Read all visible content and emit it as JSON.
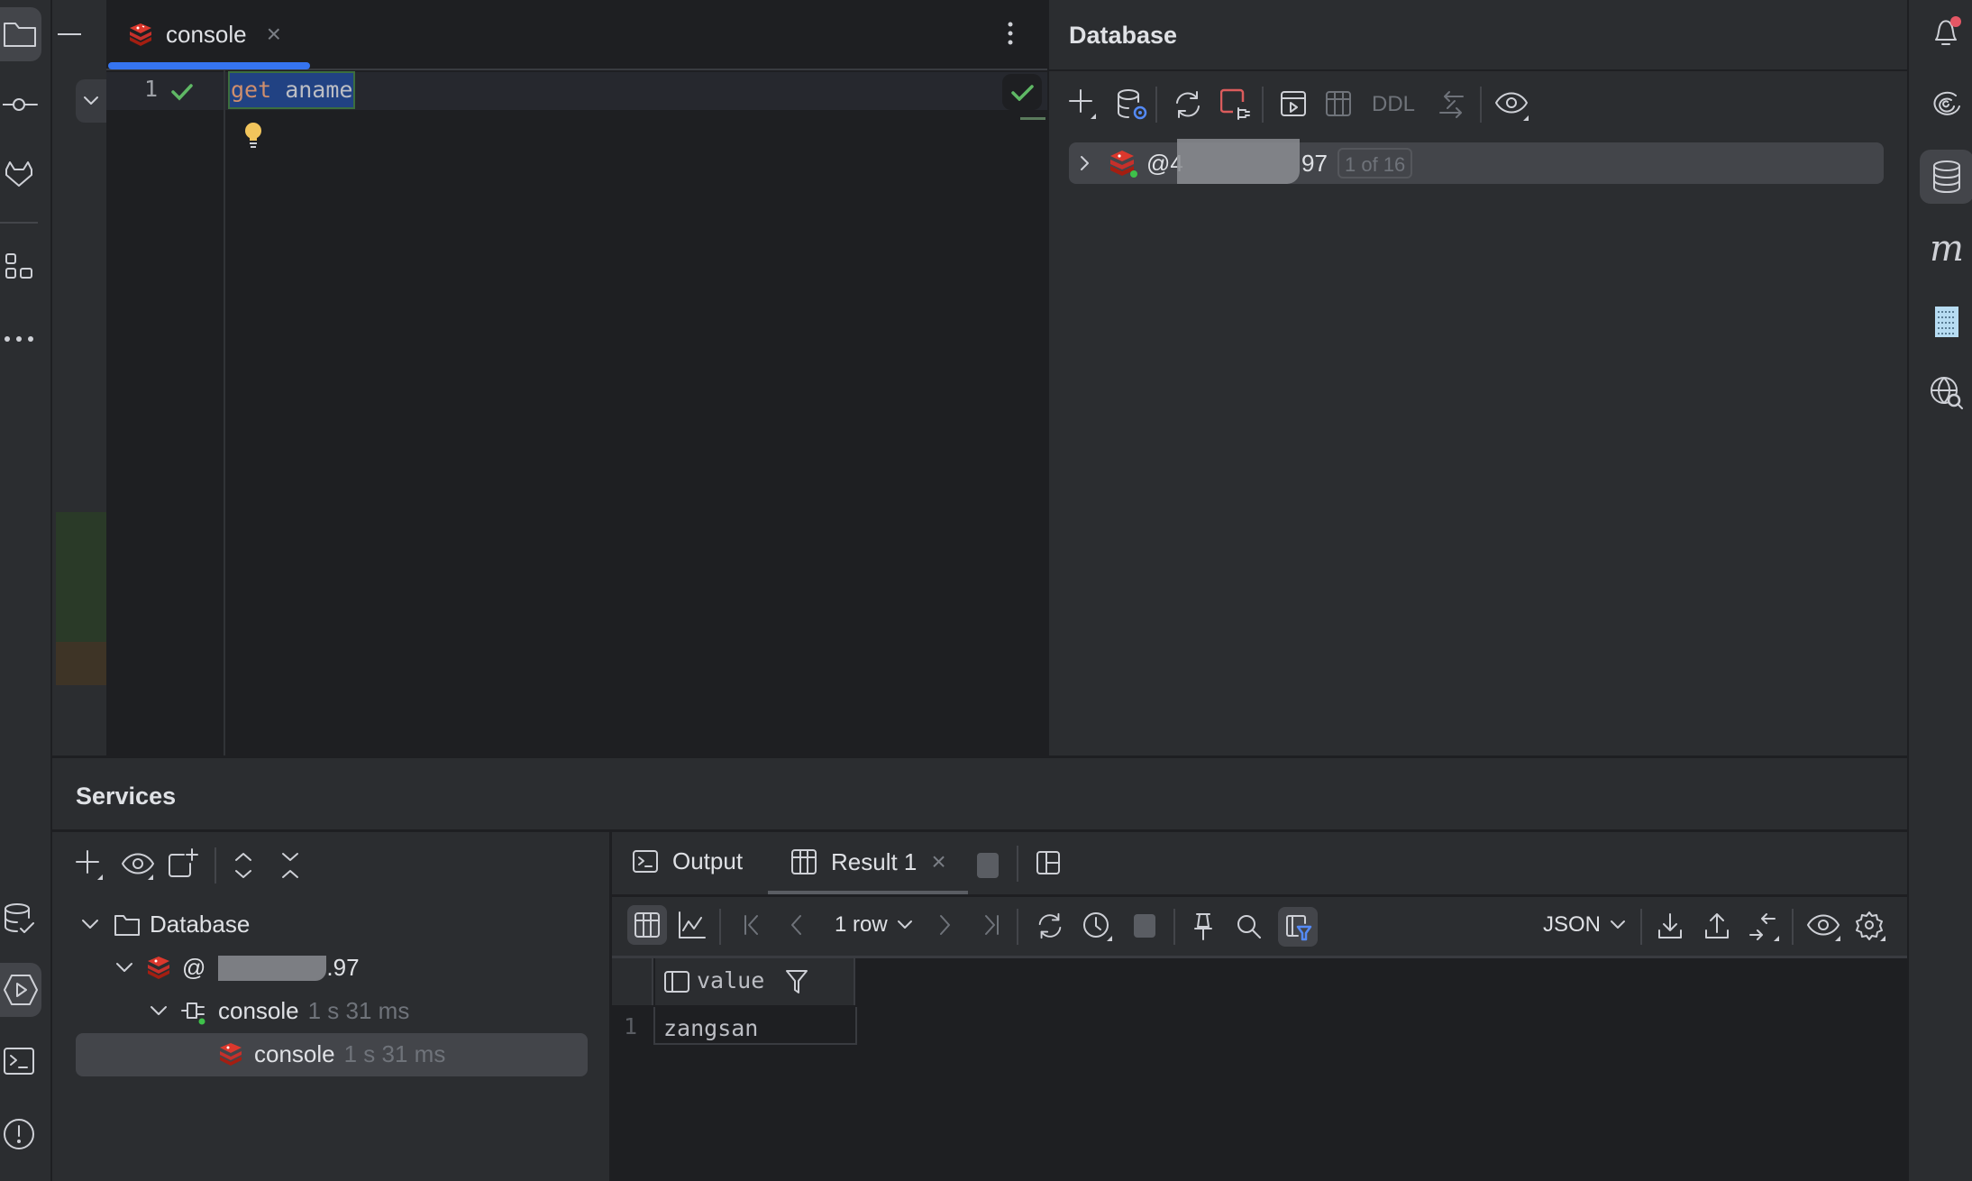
{
  "editor": {
    "tab": {
      "label": "console",
      "close": "×",
      "icon": "redis-icon"
    },
    "more_icon": "more-vertical-icon",
    "minimize_icon": "minimize-icon",
    "lines": [
      {
        "number": "1",
        "status": "check-icon",
        "tokens": [
          {
            "text": "get",
            "kind": "keyword"
          },
          {
            "text": " aname",
            "kind": "identifier"
          }
        ]
      }
    ],
    "intention_icon": "lightbulb-icon",
    "inspection_status": "check-icon"
  },
  "left_bar": {
    "top": [
      "folder-icon",
      "commit-icon",
      "gitlab-icon",
      "structure-icon",
      "more-icon"
    ],
    "bottom": [
      "database-changes-icon",
      "services-icon",
      "terminal-icon",
      "problems-icon"
    ],
    "active": "folder-icon"
  },
  "right_bar": {
    "items": [
      "notifications-icon",
      "ai-assistant-icon",
      "database-icon",
      "maven-icon",
      "binary-icon",
      "web-search-icon"
    ],
    "active": "database-icon",
    "notification_color": "#e55765"
  },
  "database_panel": {
    "title": "Database",
    "toolbar": [
      "add-icon",
      "data-source-properties-icon",
      "refresh-icon",
      "disconnect-icon",
      "query-console-icon",
      "table-icon",
      "compare-icon",
      "view-options-icon"
    ],
    "ddl_label": "DDL",
    "tree": [
      {
        "prefix": "@4",
        "redacted": true,
        "suffix": "97",
        "badge": "1 of 16",
        "expanded": false,
        "selected": true
      }
    ]
  },
  "services": {
    "title": "Services",
    "toolbar": [
      "add-icon",
      "view-options-icon",
      "new-tab-icon",
      "expand-all-icon",
      "collapse-all-icon"
    ],
    "tree": [
      {
        "label": "Database",
        "icon": "folder-icon",
        "expanded": true
      },
      {
        "prefix": "@",
        "redacted": true,
        "suffix": ".97",
        "icon": "redis-icon",
        "expanded": true
      },
      {
        "label": "console",
        "time": "1 s 31 ms",
        "icon": "plug-icon",
        "expanded": true
      },
      {
        "label": "console",
        "time": "1 s 31 ms",
        "icon": "redis-icon",
        "selected": true
      }
    ]
  },
  "results": {
    "tabs": [
      {
        "label": "Output",
        "icon": "terminal-icon",
        "active": false
      },
      {
        "label": "Result 1",
        "icon": "table-icon",
        "active": true,
        "closable": true,
        "close": "×"
      }
    ],
    "row_count": "1 row",
    "format": "JSON",
    "columns": [
      "value"
    ],
    "rows": [
      {
        "index": "1",
        "cells": [
          "zangsan"
        ]
      }
    ]
  },
  "colors": {
    "accent": "#3574f0",
    "success": "#5fb865",
    "redis": "#d82c20",
    "keyword": "#cf8e6d",
    "selection": "#214283"
  }
}
